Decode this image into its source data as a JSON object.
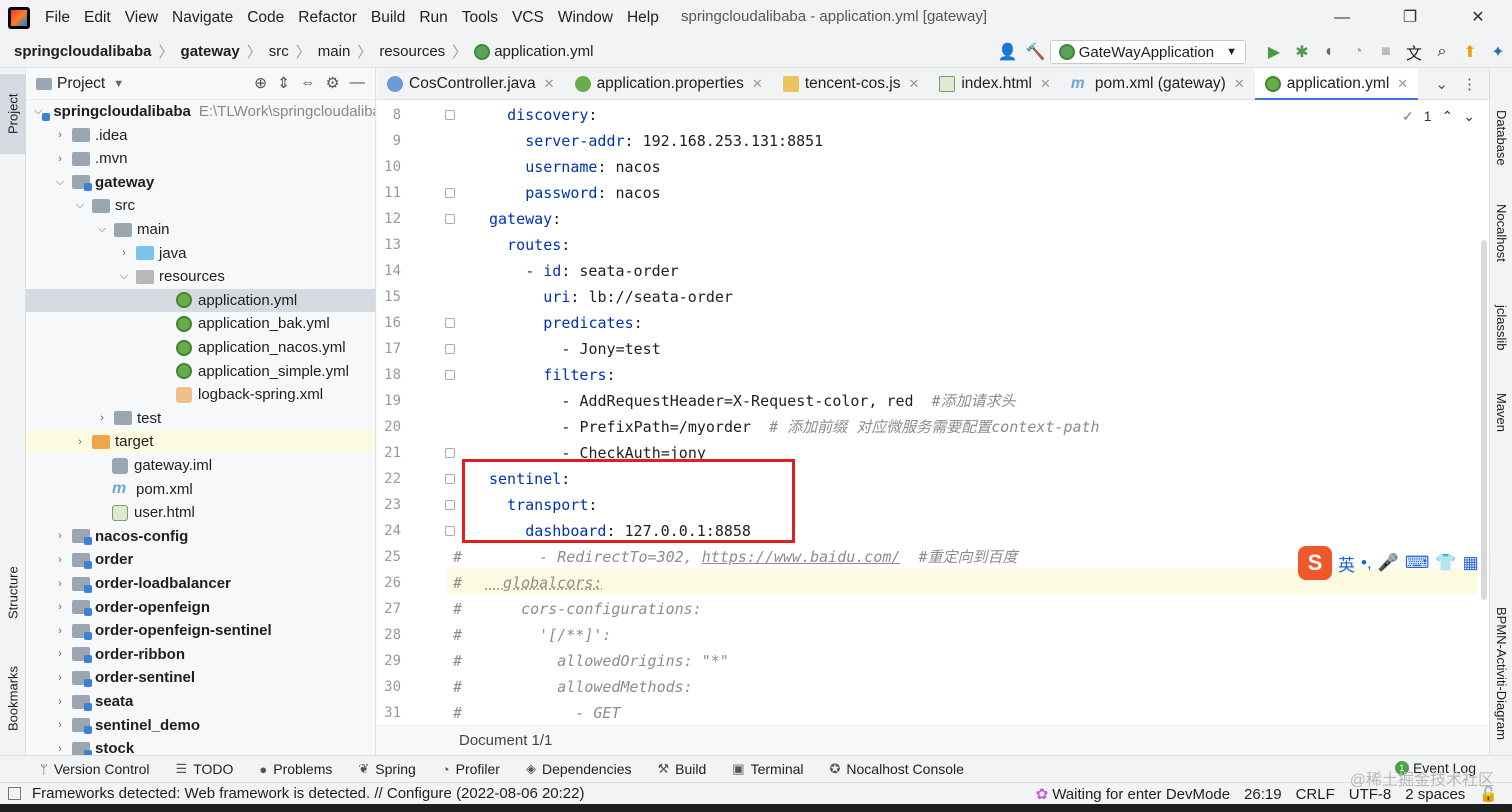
{
  "menubar": {
    "items": [
      "File",
      "Edit",
      "View",
      "Navigate",
      "Code",
      "Refactor",
      "Build",
      "Run",
      "Tools",
      "VCS",
      "Window",
      "Help"
    ],
    "window_title": "springcloudalibaba - application.yml [gateway]",
    "min": "—",
    "restore": "❐",
    "close": "✕"
  },
  "navbar": {
    "crumbs": [
      "springcloudalibaba",
      "gateway",
      "src",
      "main",
      "resources",
      "application.yml"
    ],
    "run_config": "GateWayApplication"
  },
  "left_strip": {
    "project": "Project",
    "structure": "Structure",
    "bookmarks": "Bookmarks"
  },
  "project": {
    "header": "Project",
    "tree": [
      {
        "label": "springcloudalibaba",
        "path": "E:\\TLWork\\springcloudalibaba",
        "bold": true,
        "chev": "v"
      },
      {
        "label": ".idea",
        "chev": ">"
      },
      {
        "label": ".mvn",
        "chev": ">"
      },
      {
        "label": "gateway",
        "bold": true,
        "chev": "v"
      },
      {
        "label": "src",
        "chev": "v"
      },
      {
        "label": "main",
        "chev": "v"
      },
      {
        "label": "java",
        "chev": ">"
      },
      {
        "label": "resources",
        "chev": "v"
      },
      {
        "label": "application.yml"
      },
      {
        "label": "application_bak.yml"
      },
      {
        "label": "application_nacos.yml"
      },
      {
        "label": "application_simple.yml"
      },
      {
        "label": "logback-spring.xml"
      },
      {
        "label": "test",
        "chev": ">"
      },
      {
        "label": "target",
        "chev": ">"
      },
      {
        "label": "gateway.iml"
      },
      {
        "label": "pom.xml"
      },
      {
        "label": "user.html"
      },
      {
        "label": "nacos-config",
        "bold": true,
        "chev": ">"
      },
      {
        "label": "order",
        "bold": true,
        "chev": ">"
      },
      {
        "label": "order-loadbalancer",
        "bold": true,
        "chev": ">"
      },
      {
        "label": "order-openfeign",
        "bold": true,
        "chev": ">"
      },
      {
        "label": "order-openfeign-sentinel",
        "bold": true,
        "chev": ">"
      },
      {
        "label": "order-ribbon",
        "bold": true,
        "chev": ">"
      },
      {
        "label": "order-sentinel",
        "bold": true,
        "chev": ">"
      },
      {
        "label": "seata",
        "bold": true,
        "chev": ">"
      },
      {
        "label": "sentinel_demo",
        "bold": true,
        "chev": ">"
      },
      {
        "label": "stock",
        "bold": true,
        "chev": ">"
      }
    ]
  },
  "tabs": [
    {
      "label": "CosController.java",
      "icon": "java"
    },
    {
      "label": "application.properties",
      "icon": "prop"
    },
    {
      "label": "tencent-cos.js",
      "icon": "js"
    },
    {
      "label": "index.html",
      "icon": "html"
    },
    {
      "label": "pom.xml (gateway)",
      "icon": "pom"
    },
    {
      "label": "application.yml",
      "icon": "yml",
      "active": true
    }
  ],
  "editor": {
    "inspection_count": "1",
    "lines": [
      {
        "n": "8",
        "key": "discovery",
        "val": "",
        "indent": 6
      },
      {
        "n": "9",
        "key": "server-addr",
        "val": " 192.168.253.131:8851",
        "indent": 8
      },
      {
        "n": "10",
        "key": "username",
        "val": " nacos",
        "indent": 8
      },
      {
        "n": "11",
        "key": "password",
        "val": " nacos",
        "indent": 8
      },
      {
        "n": "12",
        "key": "gateway",
        "val": "",
        "indent": 4
      },
      {
        "n": "13",
        "key": "routes",
        "val": "",
        "indent": 6
      },
      {
        "n": "14",
        "key": "- id",
        "val": " seata-order",
        "indent": 8
      },
      {
        "n": "15",
        "key": "uri",
        "val": " lb://seata-order",
        "indent": 10
      },
      {
        "n": "16",
        "key": "predicates",
        "val": "",
        "indent": 10
      },
      {
        "n": "17",
        "key": "",
        "val": "- Jony=test",
        "indent": 12
      },
      {
        "n": "18",
        "key": "filters",
        "val": "",
        "indent": 10
      },
      {
        "n": "19",
        "key": "",
        "val": "- AddRequestHeader=X-Request-color, red  ",
        "comment": "#添加请求头",
        "indent": 12
      },
      {
        "n": "20",
        "key": "",
        "val": "- PrefixPath=/myorder  ",
        "comment": "# 添加前缀 对应微服务需要配置context-path",
        "indent": 12
      },
      {
        "n": "21",
        "key": "",
        "val": "- CheckAuth=jony",
        "indent": 12
      },
      {
        "n": "22",
        "key": "sentinel",
        "val": "",
        "indent": 4
      },
      {
        "n": "23",
        "key": "transport",
        "val": "",
        "indent": 6
      },
      {
        "n": "24",
        "key": "dashboard",
        "val": " 127.0.0.1:8858",
        "indent": 8
      },
      {
        "n": "25",
        "hash": true,
        "comment": "      - RedirectTo=302, ",
        "link": "https://www.baidu.com/",
        "comment2": "  #重定向到百度",
        "indent": 0
      },
      {
        "n": "26",
        "hash": true,
        "comment": "  globalcors:",
        "indent": 0,
        "ulink": true
      },
      {
        "n": "27",
        "hash": true,
        "comment": "    cors-configurations:",
        "indent": 0
      },
      {
        "n": "28",
        "hash": true,
        "comment": "      '[/**]':",
        "indent": 0
      },
      {
        "n": "29",
        "hash": true,
        "comment": "        allowedOrigins: \"*\"",
        "indent": 0
      },
      {
        "n": "30",
        "hash": true,
        "comment": "        allowedMethods:",
        "indent": 0
      },
      {
        "n": "31",
        "hash": true,
        "comment": "          - GET",
        "indent": 0
      }
    ]
  },
  "doc_status": "Document 1/1",
  "right_strip": [
    "Database",
    "Nocalhost",
    "jclasslib",
    "Maven",
    "BPMN-Activiti-Diagram"
  ],
  "ime": {
    "logo": "S",
    "lang": "英",
    "punct": "•,",
    "mic": "🎤",
    "kbd": "⌨",
    "shirt": "👕",
    "grid": "▦"
  },
  "toolwindows": [
    "Version Control",
    "TODO",
    "Problems",
    "Spring",
    "Profiler",
    "Dependencies",
    "Build",
    "Terminal",
    "Nocalhost Console"
  ],
  "event_log": "Event Log",
  "status": {
    "message": "Frameworks detected: Web framework is detected. // Configure (2022-08-06 20:22)",
    "devmode": "Waiting for enter DevMode",
    "position": "26:19",
    "line_sep": "CRLF",
    "encoding": "UTF-8",
    "indent": "2 spaces"
  },
  "watermark": "@稀土掘金技术社区"
}
